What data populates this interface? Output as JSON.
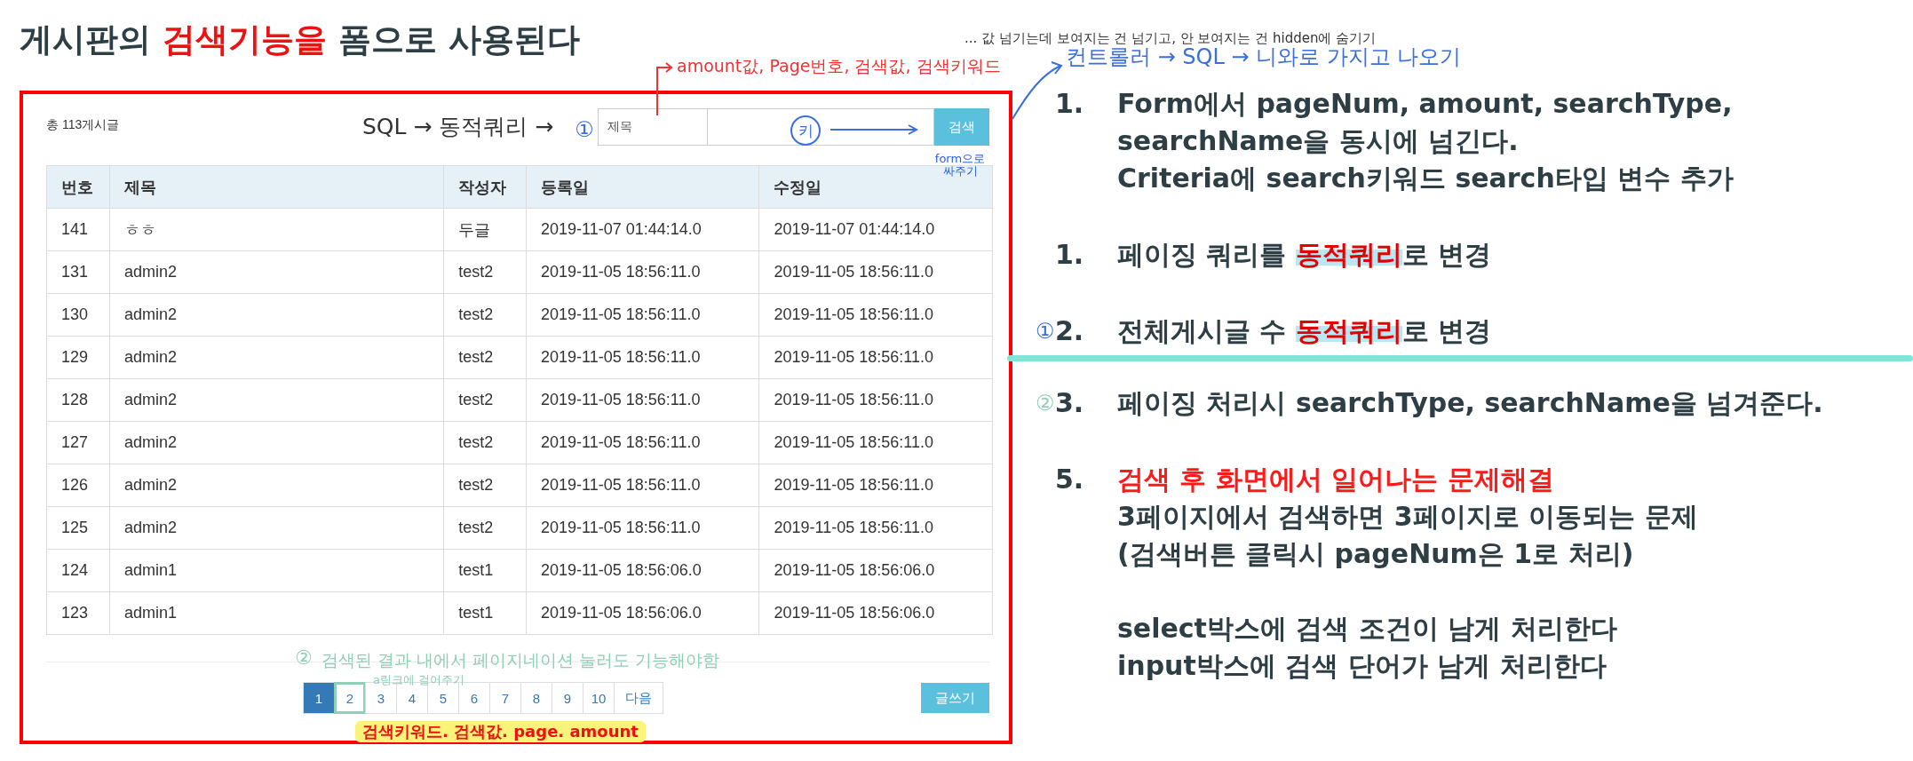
{
  "title": [
    {
      "text": "게시판의 ",
      "emphasis": false
    },
    {
      "text": "검색기능을",
      "emphasis": true
    },
    {
      "text": " 폼으로 사용된다",
      "emphasis": false
    }
  ],
  "board": {
    "total": "총 113게시글",
    "search": {
      "type": "제목",
      "button": "검색"
    },
    "table": {
      "columns": [
        "번호",
        "제목",
        "작성자",
        "등록일",
        "수정일"
      ],
      "rows": [
        [
          "141",
          "ㅎㅎ",
          "두글",
          "2019-11-07 01:44:14.0",
          "2019-11-07 01:44:14.0"
        ],
        [
          "131",
          "admin2",
          "test2",
          "2019-11-05 18:56:11.0",
          "2019-11-05 18:56:11.0"
        ],
        [
          "130",
          "admin2",
          "test2",
          "2019-11-05 18:56:11.0",
          "2019-11-05 18:56:11.0"
        ],
        [
          "129",
          "admin2",
          "test2",
          "2019-11-05 18:56:11.0",
          "2019-11-05 18:56:11.0"
        ],
        [
          "128",
          "admin2",
          "test2",
          "2019-11-05 18:56:11.0",
          "2019-11-05 18:56:11.0"
        ],
        [
          "127",
          "admin2",
          "test2",
          "2019-11-05 18:56:11.0",
          "2019-11-05 18:56:11.0"
        ],
        [
          "126",
          "admin2",
          "test2",
          "2019-11-05 18:56:11.0",
          "2019-11-05 18:56:11.0"
        ],
        [
          "125",
          "admin2",
          "test2",
          "2019-11-05 18:56:11.0",
          "2019-11-05 18:56:11.0"
        ],
        [
          "124",
          "admin1",
          "test1",
          "2019-11-05 18:56:06.0",
          "2019-11-05 18:56:06.0"
        ],
        [
          "123",
          "admin1",
          "test1",
          "2019-11-05 18:56:06.0",
          "2019-11-05 18:56:06.0"
        ]
      ]
    },
    "pagination": {
      "pages": [
        {
          "label": "1",
          "selected": true,
          "marked": false
        },
        {
          "label": "2",
          "selected": false,
          "marked": true
        },
        {
          "label": "3",
          "selected": false,
          "marked": false
        },
        {
          "label": "4",
          "selected": false,
          "marked": false
        },
        {
          "label": "5",
          "selected": false,
          "marked": false
        },
        {
          "label": "6",
          "selected": false,
          "marked": false
        },
        {
          "label": "7",
          "selected": false,
          "marked": false
        },
        {
          "label": "8",
          "selected": false,
          "marked": false
        },
        {
          "label": "9",
          "selected": false,
          "marked": false
        },
        {
          "label": "10",
          "selected": false,
          "marked": false
        }
      ],
      "next": "다음"
    },
    "write_button": "글쓰기"
  },
  "annotations": {
    "sql_note": "SQL → 동적쿼리 →",
    "sql_mark": "①",
    "key_mark": "키",
    "form_note": "form으로 싸주기",
    "params_note": "amount값, Page번호, 검색값, 검색키워드",
    "hidden_note": "... 값 넘기는데 보여지는 건 넘기고, 안 보여지는 건 hidden에 숨기기",
    "controller_note": "컨트롤러 → SQL → 니와로 가지고 나오기",
    "pagination_mark": "②",
    "pagination_note": "검색된 결과 내에서 페이지네이션 눌러도 기능해야함",
    "link_note": "a링크에 걸어주기",
    "params_tag": "검색키워드. 검색값. page. amount"
  },
  "notes": [
    {
      "number": "1.",
      "lines": [
        [
          {
            "text": "Form에서 pageNum, amount, searchType,",
            "emphasis": false
          }
        ],
        [
          {
            "text": "searchName을 동시에 넘긴다.",
            "emphasis": false
          }
        ],
        [
          {
            "text": "Criteria에 search키워드 search타입 변수 추가",
            "emphasis": false
          }
        ]
      ]
    },
    {
      "number": "1.",
      "lines": [
        [
          {
            "text": "페이징 쿼리를 ",
            "emphasis": false
          },
          {
            "text": "동적쿼리",
            "emphasis": true
          },
          {
            "text": "로 변경",
            "emphasis": false
          }
        ]
      ]
    },
    {
      "number": "2.",
      "mark": {
        "text": "①",
        "color": "#3b6fe0"
      },
      "lines": [
        [
          {
            "text": "전체게시글 수 ",
            "emphasis": false
          },
          {
            "text": "동적쿼리",
            "emphasis": true
          },
          {
            "text": "로 변경",
            "emphasis": false
          }
        ]
      ],
      "divider_after": true
    },
    {
      "number": "3.",
      "mark": {
        "text": "②",
        "color": "#8fcfb6"
      },
      "lines": [
        [
          {
            "text": "페이징 처리시 searchType, searchName을 넘겨준다.",
            "emphasis": false
          }
        ]
      ]
    },
    {
      "number": "5.",
      "heading": "검색 후 화면에서 일어나는 문제해결",
      "lines": [
        [
          {
            "text": "3페이지에서 검색하면 3페이지로 이동되는 문제",
            "emphasis": false
          }
        ],
        [
          {
            "text": "(검색버튼 클릭시 pageNum은 1로 처리)",
            "emphasis": false
          }
        ]
      ],
      "more_lines": [
        "select박스에 검색 조건이 남게 처리한다",
        "input박스에 검색 단어가 남게 처리한다"
      ]
    }
  ]
}
